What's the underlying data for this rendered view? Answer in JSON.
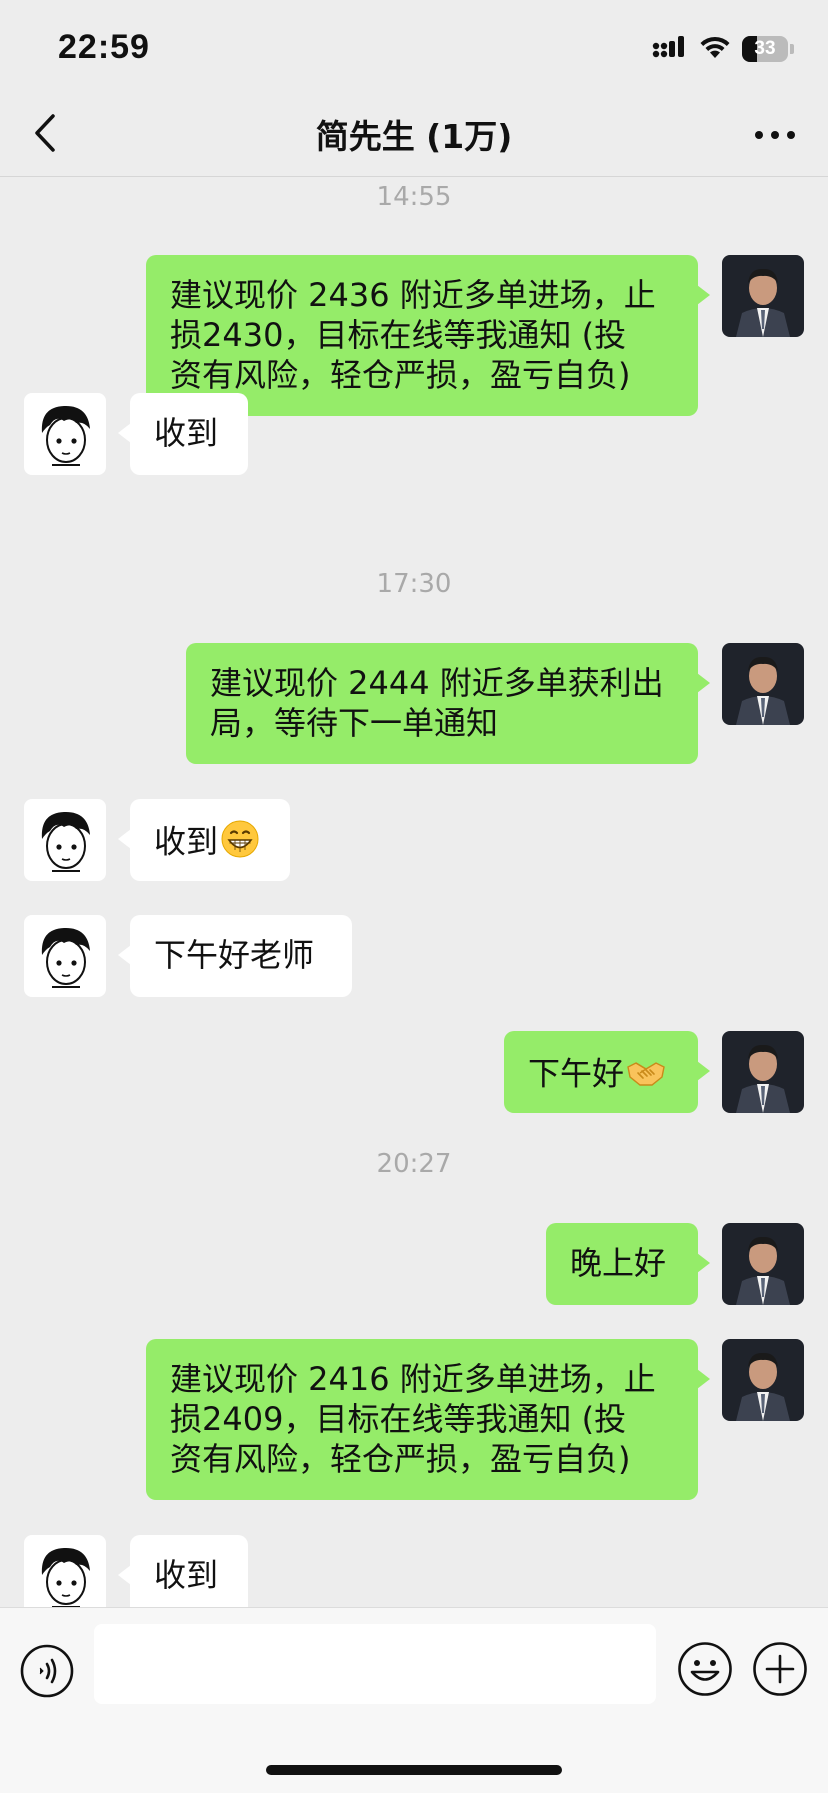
{
  "status_bar": {
    "time": "22:59",
    "battery_level": "33",
    "icons": [
      "cellular-signal-icon",
      "wifi-icon",
      "battery-icon"
    ]
  },
  "nav": {
    "title": "简先生 (1万)",
    "back_icon": "chevron-left-icon",
    "more_icon": "more-dots-icon"
  },
  "messages": [
    {
      "type": "timestamp",
      "text": "14:55"
    },
    {
      "type": "outgoing",
      "lines": [
        "建议现价 2436 附近多单进场，止",
        "损2430，目标在线等我通知 (投",
        "资有风险，轻仓严损，盈亏自负)"
      ]
    },
    {
      "type": "incoming",
      "lines": [
        "收到"
      ]
    },
    {
      "type": "timestamp",
      "text": "17:30"
    },
    {
      "type": "outgoing",
      "lines": [
        "建议现价 2444 附近多单获利出",
        "局，等待下一单通知"
      ]
    },
    {
      "type": "incoming",
      "lines": [
        "收到"
      ],
      "emoji": "grinning-face-emoji"
    },
    {
      "type": "incoming",
      "lines": [
        "下午好老师"
      ]
    },
    {
      "type": "outgoing",
      "lines": [
        "下午好"
      ],
      "emoji": "handshake-emoji"
    },
    {
      "type": "timestamp",
      "text": "20:27"
    },
    {
      "type": "outgoing",
      "lines": [
        "晚上好"
      ]
    },
    {
      "type": "outgoing",
      "lines": [
        "建议现价 2416 附近多单进场，止",
        "损2409，目标在线等我通知 (投",
        "资有风险，轻仓严损，盈亏自负)"
      ]
    },
    {
      "type": "incoming",
      "lines": [
        "收到"
      ]
    }
  ],
  "input_bar": {
    "voice_icon": "voice-icon",
    "input_value": "",
    "input_placeholder": "",
    "emoji_icon": "emoji-icon",
    "plus_icon": "plus-icon"
  },
  "colors": {
    "background": "#ededed",
    "outgoing_bubble": "#95ec69",
    "incoming_bubble": "#ffffff",
    "timestamp_text": "#a9a9a9"
  }
}
